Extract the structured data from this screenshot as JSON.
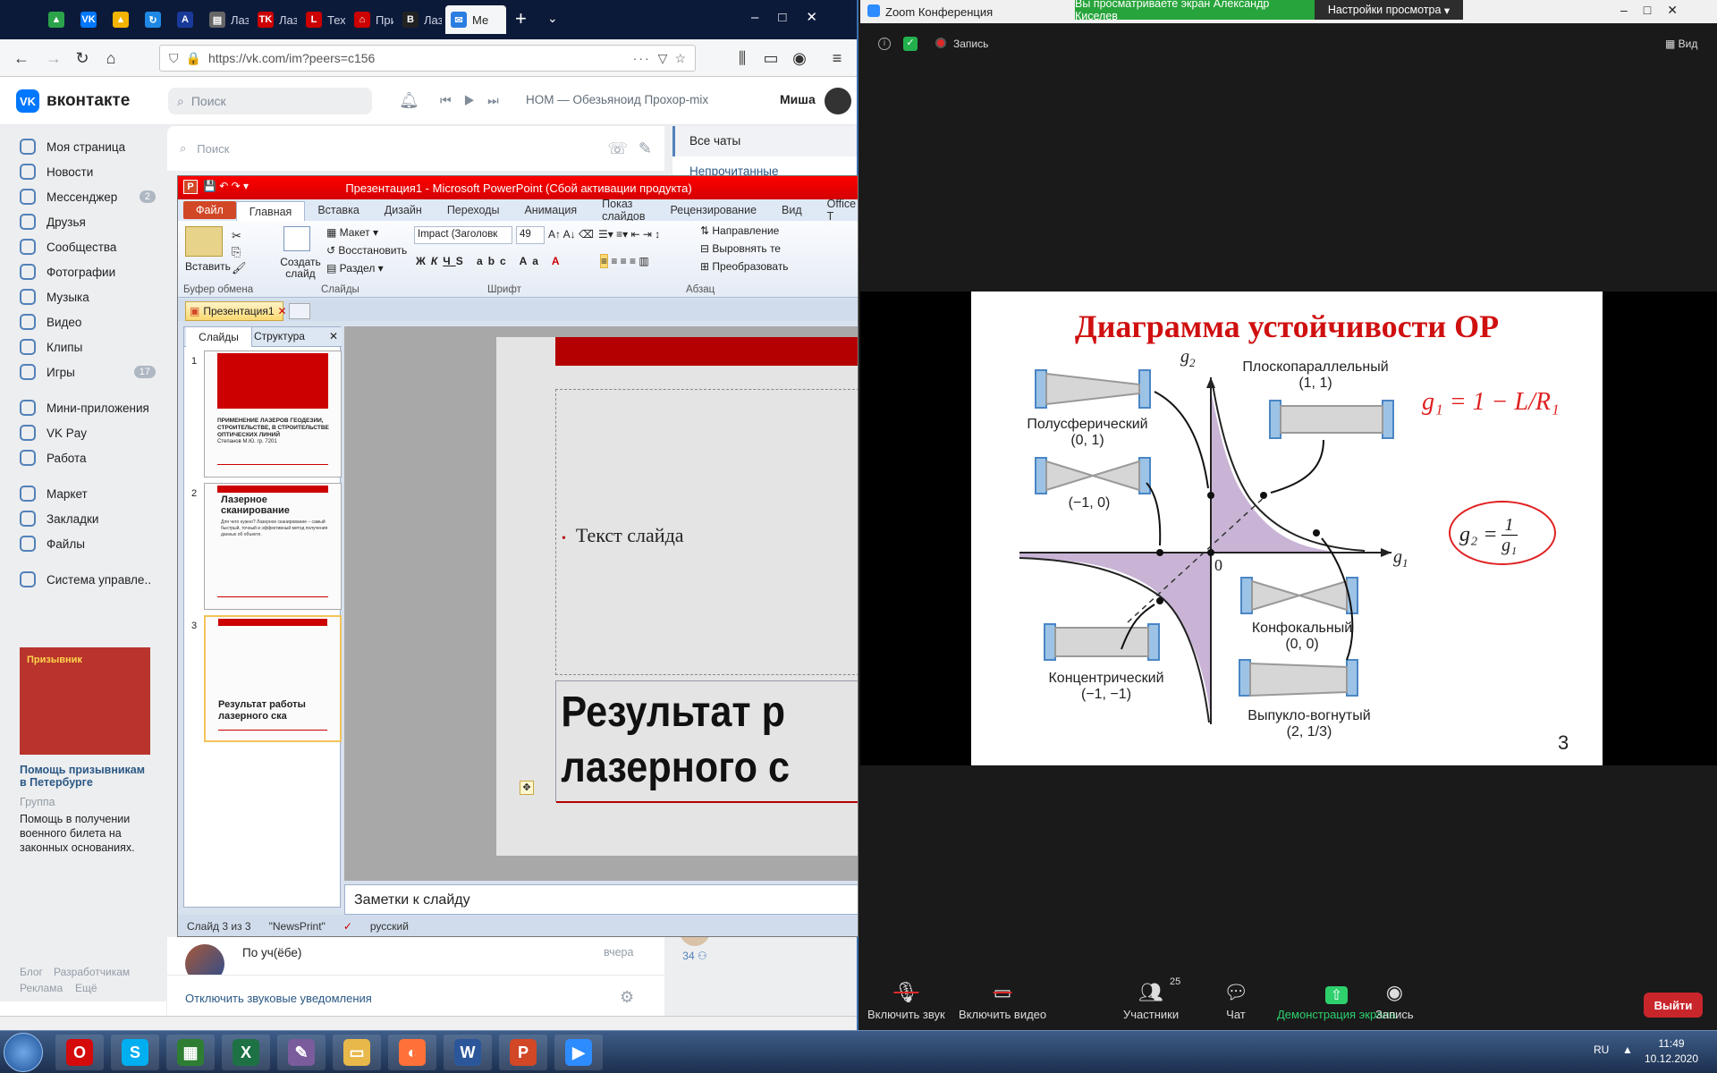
{
  "firefox": {
    "tabs": [
      {
        "label": "",
        "icon": "google-drive-icon",
        "color": "#2ba34b"
      },
      {
        "label": "",
        "icon": "vk-icon",
        "color": "#0077ff"
      },
      {
        "label": "",
        "icon": "google-drive-icon",
        "color": "#f4b400"
      },
      {
        "label": "",
        "icon": "refresh-logo-icon",
        "color": "#1e88e5"
      },
      {
        "label": "",
        "icon": "a-letter-icon",
        "color": "#1a3a9a"
      },
      {
        "label": "Лазер",
        "icon": "page-icon",
        "color": "#666"
      },
      {
        "label": "Лазер",
        "icon": "tk-logo-icon",
        "color": "#c00"
      },
      {
        "label": "Техни",
        "icon": "l-logo-icon",
        "color": "#c00"
      },
      {
        "label": "Прим",
        "icon": "house-icon",
        "color": "#c00"
      },
      {
        "label": "Лазер",
        "icon": "b-logo-icon",
        "color": "#222"
      },
      {
        "label": "Ме",
        "icon": "message-icon",
        "color": "#2a7de1"
      }
    ],
    "url": "https://vk.com/im?peers=c156"
  },
  "vk": {
    "logo": "вконтакте",
    "search_placeholder": "Поиск",
    "player_track": "НОМ — Обезьяноид Прохор-mix",
    "user_name": "Миша",
    "menu": [
      {
        "label": "Моя страница"
      },
      {
        "label": "Новости"
      },
      {
        "label": "Мессенджер",
        "badge": "2"
      },
      {
        "label": "Друзья"
      },
      {
        "label": "Сообщества"
      },
      {
        "label": "Фотографии"
      },
      {
        "label": "Музыка"
      },
      {
        "label": "Видео"
      },
      {
        "label": "Клипы"
      },
      {
        "label": "Игры",
        "badge": "17"
      },
      {
        "label": "Мини-приложения"
      },
      {
        "label": "VK Pay"
      },
      {
        "label": "Работа"
      },
      {
        "label": "Маркет"
      },
      {
        "label": "Закладки"
      },
      {
        "label": "Файлы"
      },
      {
        "label": "Система управле.."
      }
    ],
    "ad": {
      "image_text": "Призывник",
      "title": "Помощь призывникам в Петербурге",
      "type": "Группа",
      "text": "Помощь в получении военного билета на законных основаниях."
    },
    "footer": [
      "Блог",
      "Разработчикам",
      "Реклама",
      "Ещё"
    ],
    "chat_search_placeholder": "Поиск",
    "filters": [
      "Все чаты",
      "Непрочитанные"
    ],
    "chat_row": {
      "name": "По уч(ёбе)",
      "time": "вчера"
    },
    "mute_link": "Отключить звуковые уведомления",
    "online_count": "34"
  },
  "powerpoint": {
    "title": "Презентация1 - Microsoft PowerPoint (Сбой активации продукта)",
    "ribbon_tabs": [
      "Файл",
      "Главная",
      "Вставка",
      "Дизайн",
      "Переходы",
      "Анимация",
      "Показ слайдов",
      "Рецензирование",
      "Вид",
      "Office T"
    ],
    "clipboard": {
      "paste": "Вставить",
      "group": "Буфер обмена"
    },
    "slides_group": {
      "new_slide": "Создать слайд",
      "layout": "Макет",
      "reset": "Восстановить",
      "section": "Раздел",
      "group": "Слайды"
    },
    "font_group": {
      "font": "Impact (Заголовк",
      "size": "49",
      "group": "Шрифт"
    },
    "para_group": {
      "direction": "Направление",
      "align": "Выровнять те",
      "convert": "Преобразовать",
      "group": "Абзац"
    },
    "doc_tab": "Презентация1",
    "pane_tabs": [
      "Слайды",
      "Структура"
    ],
    "thumbs": [
      {
        "num": "1",
        "text": "ПРИМЕНЕНИЕ ЛАЗЕРОВ ГЕОДЕЗИИ, СТРОИТЕЛЬСТВЕ, В СТРОИТЕЛЬСТВЕ ОПТИЧЕСКИХ ЛИНИЙ",
        "sub": "Степанов М.Ю. гр. 7201"
      },
      {
        "num": "2",
        "text": "Лазерное сканирование",
        "sub": "Для чего нужно? Лазерное сканирование – самый быстрый, точный и эффективный метод получения данных об объекте."
      },
      {
        "num": "3",
        "text": "Результат работы лазерного ска",
        "sub": ""
      }
    ],
    "slide_bullet": "Текст слайда",
    "slide_title_l1": "Результат р",
    "slide_title_l2": "лазерного с",
    "notes": "Заметки к слайду",
    "status": {
      "slide": "Слайд 3 из 3",
      "theme": "\"NewsPrint\"",
      "lang": "русский"
    }
  },
  "zoom": {
    "title": "Zoom Конференция",
    "banner": "Вы просматриваете экран Александр Киселев",
    "view_settings": "Настройки просмотра",
    "recording": "Запись",
    "view": "Вид",
    "slide": {
      "title": "Диаграмма устойчивости ОР",
      "axis_g2": "g",
      "axis_g1": "g",
      "origin": "0",
      "labels": [
        {
          "name": "Плоскопараллельный",
          "coords": "(1, 1)"
        },
        {
          "name": "Полусферический",
          "coords": "(0, 1)"
        },
        {
          "name": "",
          "coords": "(−1, 0)"
        },
        {
          "name": "Конфокальный",
          "coords": "(0, 0)"
        },
        {
          "name": "Концентрический",
          "coords": "(−1, −1)"
        },
        {
          "name": "Выпукло-вогнутый",
          "coords": "(2, 1/3)"
        }
      ],
      "formula_g2": "g₂ =",
      "formula_g2_num": "1",
      "formula_g2_den": "g₁",
      "handwriting": "g₁ = 1 − L/R₁",
      "page_number": "3"
    },
    "toolbar": [
      {
        "label": "Включить звук",
        "icon": "mic-muted-icon"
      },
      {
        "label": "Включить видео",
        "icon": "video-off-icon"
      },
      {
        "label": "Участники",
        "icon": "participants-icon",
        "count": "25"
      },
      {
        "label": "Чат",
        "icon": "chat-icon"
      },
      {
        "label": "Демонстрация экрана",
        "icon": "share-screen-icon"
      },
      {
        "label": "Запись",
        "icon": "record-icon"
      }
    ],
    "leave": "Выйти",
    "accent": "#2ed06e",
    "leave_color": "#c9262c"
  },
  "taskbar": {
    "apps": [
      {
        "icon": "opera-icon",
        "color": "#d50a0a"
      },
      {
        "icon": "skype-icon",
        "color": "#00aff0"
      },
      {
        "icon": "spreadsheet-icon",
        "color": "#2e7d32"
      },
      {
        "icon": "excel-icon",
        "color": "#1e7145"
      },
      {
        "icon": "paint-icon",
        "color": "#7a5c9c"
      },
      {
        "icon": "folder-icon",
        "color": "#e8b84a"
      },
      {
        "icon": "firefox-icon",
        "color": "#ff7139"
      },
      {
        "icon": "word-icon",
        "color": "#2b579a"
      },
      {
        "icon": "powerpoint-icon",
        "color": "#d24726"
      },
      {
        "icon": "zoom-icon",
        "color": "#2d8cff"
      }
    ],
    "lang": "RU",
    "time": "11:49",
    "date": "10.12.2020"
  }
}
